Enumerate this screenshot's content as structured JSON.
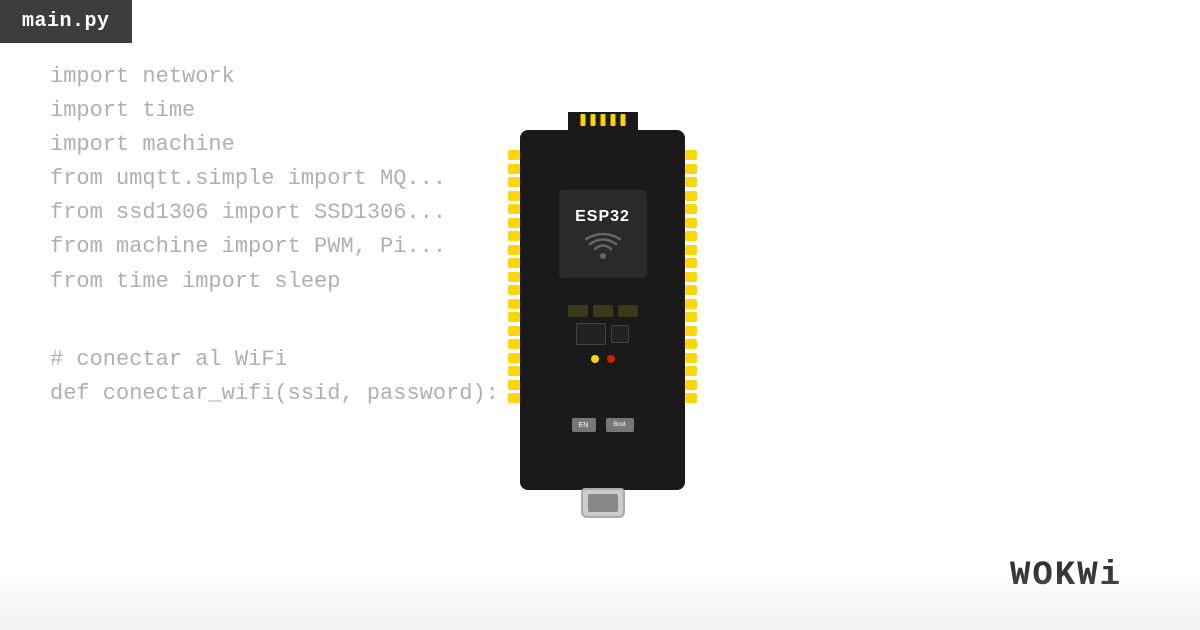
{
  "tab": {
    "label": "main.py"
  },
  "code": {
    "lines": [
      "import network",
      "import time",
      "import machine",
      "from umqtt.simple import MQ...",
      "from ssd1306 import SSD1306...",
      "from machine import PWM, Pi...",
      "from time import sleep"
    ],
    "spacer1": "",
    "comment1": "# conectar al WiFi",
    "def1": "def conectar_wifi(ssid, password):"
  },
  "chip": {
    "label": "ESP32"
  },
  "logo": {
    "text": "WOKWi"
  },
  "colors": {
    "background": "#ffffff",
    "tab_bg": "#3d3d3d",
    "tab_text": "#ffffff",
    "code_text": "#b0b0b0",
    "board_bg": "#1a1a1a",
    "pin_color": "#ffd700",
    "logo_color": "#333333"
  }
}
